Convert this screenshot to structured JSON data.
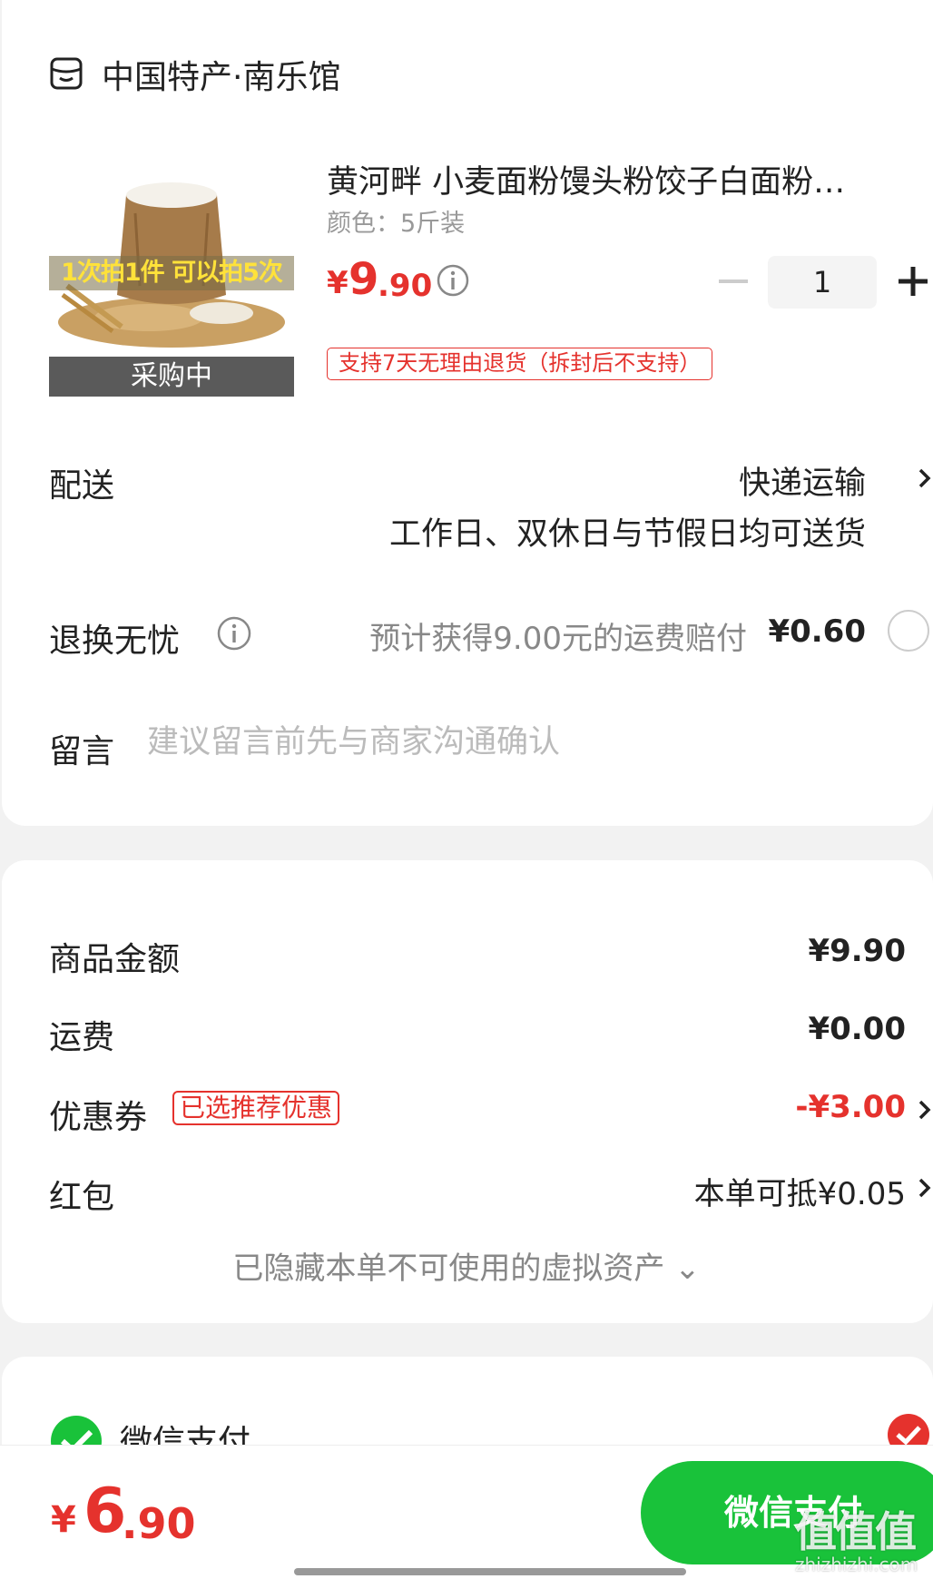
{
  "store": {
    "name": "中国特产·南乐馆",
    "icon": "store-icon"
  },
  "product": {
    "title": "黄河畔 小麦面粉馒头粉饺子白面粉…",
    "variant": "颜色：5斤装",
    "promo_banner": "1次拍1件 可以拍5次",
    "status": "采购中",
    "price_symbol": "¥",
    "price_int": "9",
    "price_dec": ".90",
    "quantity": "1",
    "return_policy": "支持7天无理由退货（拆封后不支持）"
  },
  "delivery": {
    "label": "配送",
    "value": "快递运输",
    "subtext": "工作日、双休日与节假日均可送货"
  },
  "return_insurance": {
    "label": "退换无忧",
    "description": "预计获得9.00元的运费赔付",
    "price": "¥0.60"
  },
  "note": {
    "label": "留言",
    "placeholder": "建议留言前先与商家沟通确认"
  },
  "costs": {
    "goods_label": "商品金额",
    "goods_value": "¥9.90",
    "shipping_label": "运费",
    "shipping_value": "¥0.00",
    "coupon_label": "优惠券",
    "coupon_badge": "已选推荐优惠",
    "coupon_value": "-¥3.00",
    "redpacket_label": "红包",
    "redpacket_value": "本单可抵¥0.05",
    "hidden_assets": "已隐藏本单不可使用的虚拟资产 ⌄"
  },
  "payment": {
    "method_label": "微信支付",
    "total_symbol": "¥",
    "total_int": "6",
    "total_dec": ".90",
    "pay_button": "微信支付"
  },
  "watermark": {
    "logo": "值值值",
    "url": "zhizhizhi.com"
  },
  "colors": {
    "accent": "#e5322d",
    "wechat_green": "#19c23a",
    "background": "#f2f2f2"
  }
}
